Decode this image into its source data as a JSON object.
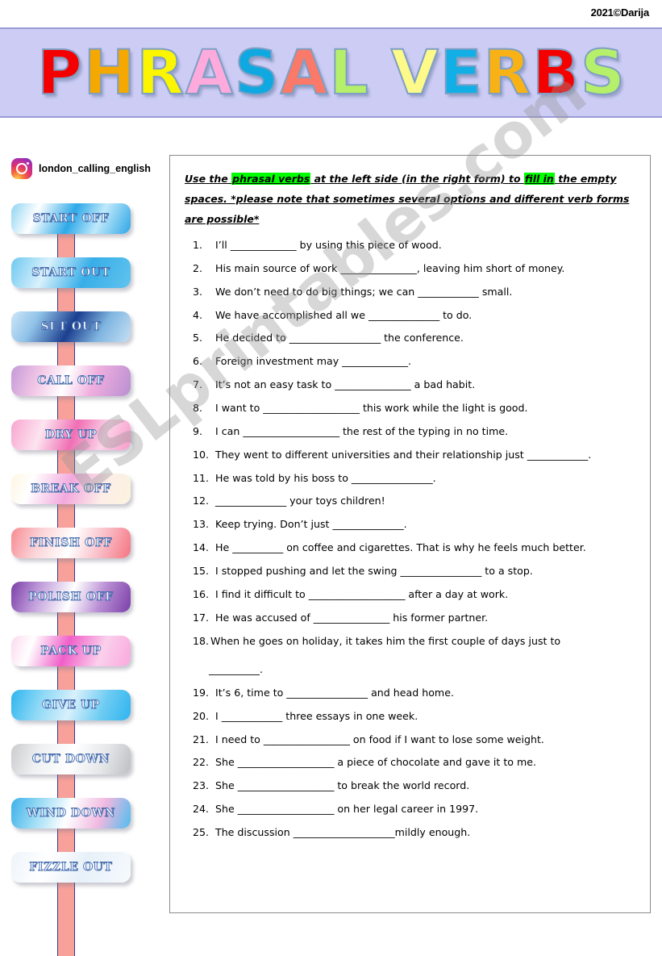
{
  "header": {
    "copyright": "2021©Darija"
  },
  "title": {
    "letters": [
      {
        "char": "P",
        "color": "#f40000"
      },
      {
        "char": "H",
        "color": "#f5a800"
      },
      {
        "char": "R",
        "color": "#fcf500"
      },
      {
        "char": "A",
        "color": "#ffaadd"
      },
      {
        "char": "S",
        "color": "#0fa8e0"
      },
      {
        "char": "A",
        "color": "#fa7968"
      },
      {
        "char": "L",
        "color": "#b6f06a"
      },
      {
        "char": " ",
        "color": ""
      },
      {
        "char": "V",
        "color": "#fdfa8a"
      },
      {
        "char": "E",
        "color": "#12aee6"
      },
      {
        "char": "R",
        "color": "#f9b216"
      },
      {
        "char": "B",
        "color": "#f40000"
      },
      {
        "char": "S",
        "color": "#b6f06a"
      }
    ]
  },
  "sidebar": {
    "instagram_handle": "london_calling_english",
    "verbs": [
      {
        "label": "START OFF",
        "gradient": "linear-gradient(115deg,#8ed4f2 0%,#ffffff 22%,#2ea9e8 50%,#bfe9fb 72%,#2fa6e5 100%)"
      },
      {
        "label": "START OUT",
        "gradient": "linear-gradient(115deg,#6ec8f0 0%,#d9f1fc 30%,#37aee8 62%,#61c3ee 100%)"
      },
      {
        "label": "SET OUT",
        "gradient": "linear-gradient(120deg,#cfe6f7 0%,#8fc2e8 22%,#1c3f8f 50%,#7fb5e0 74%,#c6e0f4 100%)"
      },
      {
        "label": "CALL OFF",
        "gradient": "linear-gradient(110deg,#c49ad8 0%,#f2c6e6 24%,#ffffff 46%,#f0aede 68%,#b98fd2 100%)"
      },
      {
        "label": "DRY UP",
        "gradient": "linear-gradient(110deg,#f7a6cf 0%,#fde4f0 26%,#f06fb4 52%,#fbd4e8 76%,#f79ac9 100%)"
      },
      {
        "label": "BREAK OFF",
        "gradient": "linear-gradient(110deg,#fdf6e0 0%,#ffffff 18%,#f2a8dd 48%,#fdeee8 76%,#fbf3dd 100%)"
      },
      {
        "label": "FINISH OFF",
        "gradient": "linear-gradient(110deg,#f78b92 0%,#fbd2d6 24%,#ffffff 50%,#f9b9c3 76%,#f4747f 100%)"
      },
      {
        "label": "POLISH OFF",
        "gradient": "linear-gradient(110deg,#7b3fa8 0%,#c39fdc 24%,#ffffff 50%,#b98ed4 74%,#7b3fa8 100%)"
      },
      {
        "label": "PACK UP",
        "gradient": "linear-gradient(110deg,#fbd9ee 0%,#ffffff 18%,#f05fc8 46%,#fbd0ec 74%,#f9a8dd 100%)"
      },
      {
        "label": "GIVE UP",
        "gradient": "linear-gradient(110deg,#2fb4ef 0%,#8fd9f6 26%,#d8f0fc 50%,#6ccbf2 76%,#2fb4ef 100%)"
      },
      {
        "label": "CUT DOWN",
        "gradient": "linear-gradient(110deg,#c9cbcd 0%,#eef0f1 24%,#ffffff 50%,#e4e6e8 76%,#bcbfc2 100%)"
      },
      {
        "label": "WIND DOWN",
        "gradient": "linear-gradient(110deg,#3cb0e8 0%,#9ddcf5 24%,#ffffff 48%,#f0b8e0 74%,#4fbdee 100%)"
      },
      {
        "label": "FIZZLE OUT",
        "gradient": "linear-gradient(110deg,#eef4fa 0%,#ffffff 30%,#e7f0f9 60%,#f6fafd 100%)"
      }
    ]
  },
  "exercise": {
    "instructions": {
      "part1": "Use the ",
      "highlight1": "phrasal verbs",
      "part2": " at the left side (in the right form) to ",
      "highlight2": "fill in",
      "part3": " the empty spaces. *please note that sometimes several options and different verb forms are possible*"
    },
    "questions": [
      {
        "num": "1.",
        "text": "I’ll _____________ by using this piece of wood."
      },
      {
        "num": "2.",
        "text": "His main source of work _______________, leaving him short of money."
      },
      {
        "num": "3.",
        "text": "We don’t need to do big things; we can ____________ small."
      },
      {
        "num": "4.",
        "text": "We have accomplished all we ______________ to do."
      },
      {
        "num": "5.",
        "text": "He decided to __________________ the conference."
      },
      {
        "num": "6.",
        "text": "Foreign investment may _____________."
      },
      {
        "num": "7.",
        "text": "It’s not an easy task to _______________ a bad habit."
      },
      {
        "num": "8.",
        "text": "I want to ___________________ this work while the light is good."
      },
      {
        "num": "9.",
        "text": "I can ___________________ the rest of the typing in no time."
      },
      {
        "num": "10.",
        "text": "They went to different universities and their relationship just ____________."
      },
      {
        "num": "11.",
        "text": "He was told by his boss to ________________."
      },
      {
        "num": "12.",
        "text": "______________ your toys children!"
      },
      {
        "num": "13.",
        "text": "Keep trying. Don’t just ______________."
      },
      {
        "num": "14.",
        "text": "He __________ on coffee and cigarettes. That is why he feels much better."
      },
      {
        "num": "15.",
        "text": "I stopped pushing and let the swing ________________ to a stop."
      },
      {
        "num": "16.",
        "text": "I find it difficult to ___________________ after a day at work."
      },
      {
        "num": "17.",
        "text": "He was accused of _______________ his former partner."
      },
      {
        "num": "18.",
        "text": "When he goes on holiday, it takes him the first couple of days just to",
        "continuation": "__________."
      },
      {
        "num": "19.",
        "text": "It’s 6, time to ________________ and head home."
      },
      {
        "num": "20.",
        "text": "I ____________ three essays in one week."
      },
      {
        "num": "21.",
        "text": "I need to _________________ on food if I want to lose some weight."
      },
      {
        "num": "22.",
        "text": "She ___________________ a piece of chocolate and gave it to me."
      },
      {
        "num": "23.",
        "text": "She ___________________ to break the world record."
      },
      {
        "num": "24.",
        "text": "She ___________________ on her legal career in 1997."
      },
      {
        "num": "25.",
        "text": "The discussion ____________________mildly enough."
      }
    ]
  },
  "watermark": {
    "text": "ESLprintables.com"
  }
}
